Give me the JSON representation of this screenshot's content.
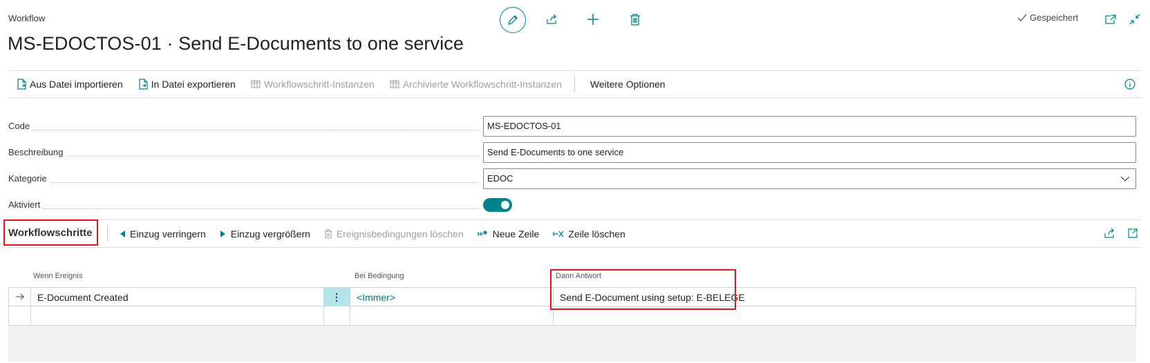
{
  "header": {
    "page_type": "Workflow",
    "title": "MS-EDOCTOS-01 · Send E-Documents to one service",
    "saved_status": "Gespeichert"
  },
  "actions": [
    {
      "label": "Aus Datei importieren",
      "icon": "file-import-icon",
      "enabled": true
    },
    {
      "label": "In Datei exportieren",
      "icon": "file-export-icon",
      "enabled": true
    },
    {
      "label": "Workflowschritt-Instanzen",
      "icon": "table-icon",
      "enabled": false
    },
    {
      "label": "Archivierte Workflowschritt-Instanzen",
      "icon": "table-icon",
      "enabled": false
    }
  ],
  "more_options": "Weitere Optionen",
  "fields": {
    "code": {
      "label": "Code",
      "value": "MS-EDOCTOS-01"
    },
    "description": {
      "label": "Beschreibung",
      "value": "Send E-Documents to one service"
    },
    "category": {
      "label": "Kategorie",
      "value": "EDOC"
    },
    "enabled": {
      "label": "Aktiviert",
      "value": true
    }
  },
  "steps_part": {
    "title": "Workflowschritte",
    "actions": [
      {
        "label": "Einzug verringern",
        "icon": "triangle-left-icon",
        "enabled": true
      },
      {
        "label": "Einzug vergrößern",
        "icon": "triangle-right-icon",
        "enabled": true
      },
      {
        "label": "Ereignisbedingungen löschen",
        "icon": "trash-icon",
        "enabled": false
      },
      {
        "label": "Neue Zeile",
        "icon": "new-line-icon",
        "enabled": true
      },
      {
        "label": "Zeile löschen",
        "icon": "delete-line-icon",
        "enabled": true
      }
    ],
    "columns": [
      "Wenn Ereignis",
      "Bei Bedingung",
      "Dann Antwort"
    ],
    "rows": [
      {
        "event": "E-Document Created",
        "condition": "<Immer>",
        "response": "Send E-Document using setup: E-BELEGE"
      },
      {
        "event": "",
        "condition": "",
        "response": ""
      }
    ]
  },
  "colors": {
    "accent": "#00838a",
    "highlight": "#e0141e",
    "row_menu": "#b3e5ea"
  }
}
